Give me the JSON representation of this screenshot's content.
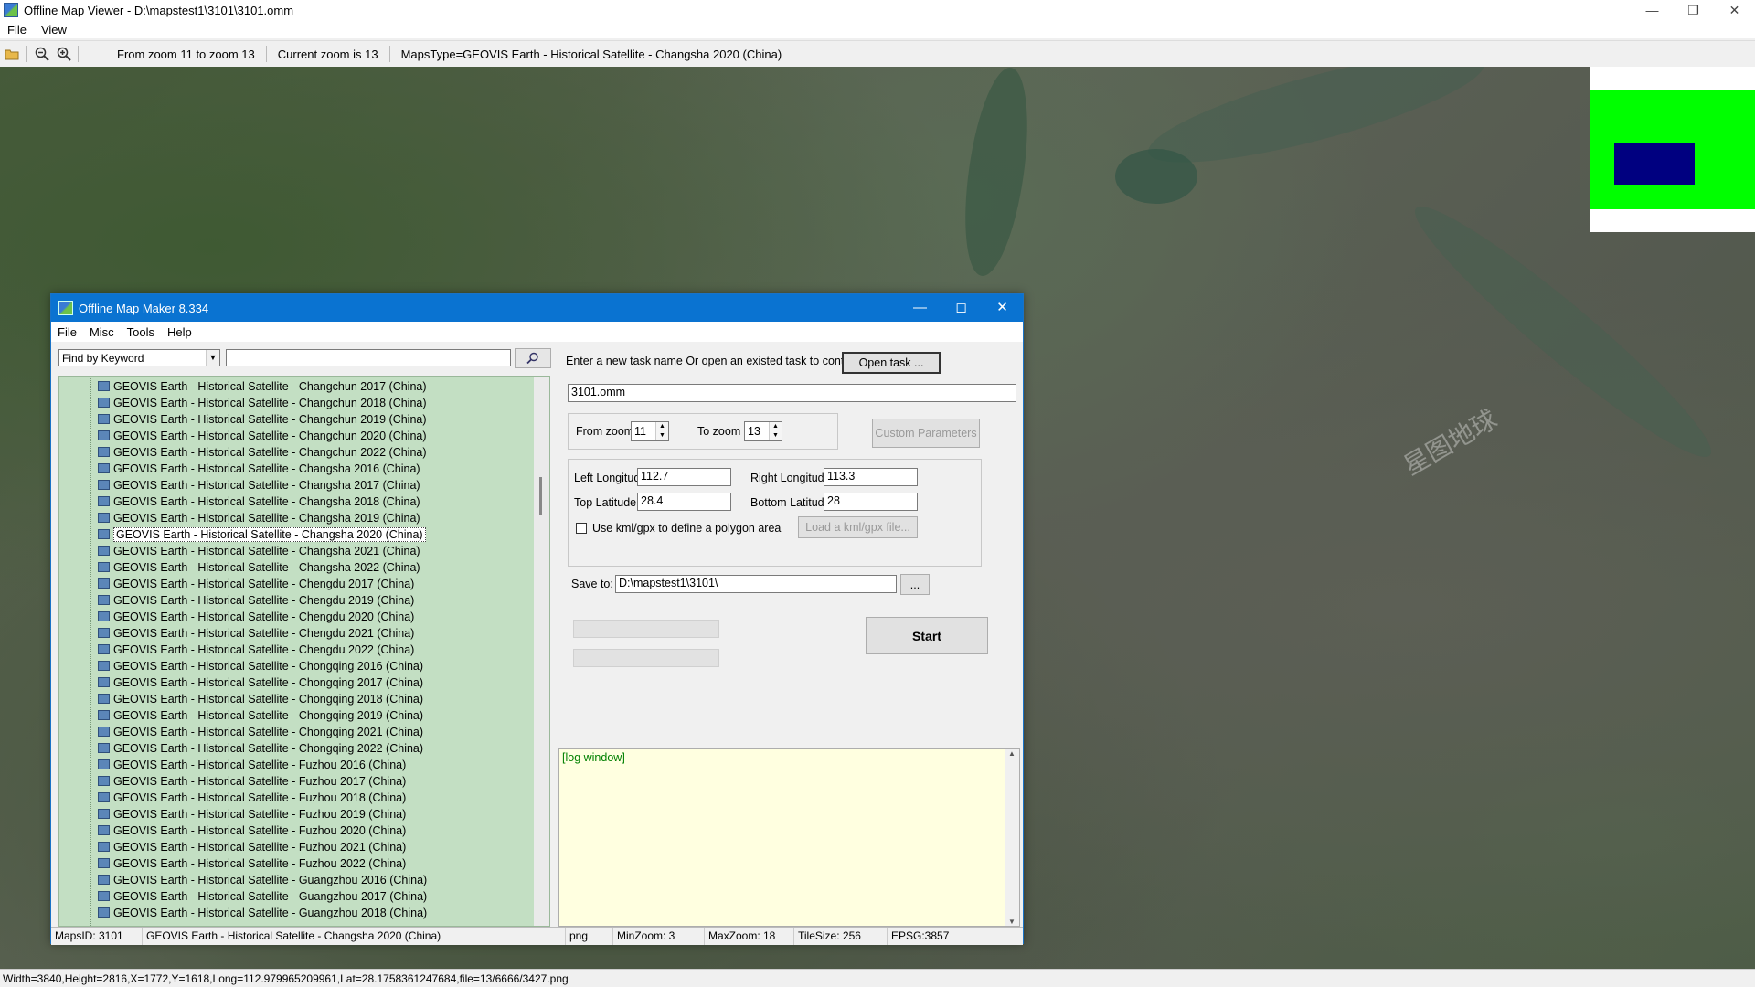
{
  "viewer": {
    "title": "Offline Map Viewer - D:\\mapstest1\\3101\\3101.omm",
    "menu": [
      "File",
      "View"
    ],
    "toolbar": {
      "zoom_range": "From zoom 11 to zoom 13",
      "current_zoom": "Current zoom is 13",
      "maps_type": "MapsType=GEOVIS Earth - Historical Satellite - Changsha 2020 (China)"
    },
    "status": "Width=3840,Height=2816,X=1772,Y=1618,Long=112.979965209961,Lat=28.1758361247684,file=13/6666/3427.png",
    "watermark": "星图地球"
  },
  "dialog": {
    "title": "Offline Map Maker 8.334",
    "menu": [
      "File",
      "Misc",
      "Tools",
      "Help"
    ],
    "find_mode": "Find by Keyword",
    "search_value": "",
    "tree_items": [
      "GEOVIS Earth - Historical Satellite - Changchun 2017 (China)",
      "GEOVIS Earth - Historical Satellite - Changchun 2018 (China)",
      "GEOVIS Earth - Historical Satellite - Changchun 2019 (China)",
      "GEOVIS Earth - Historical Satellite - Changchun 2020 (China)",
      "GEOVIS Earth - Historical Satellite - Changchun 2022 (China)",
      "GEOVIS Earth - Historical Satellite - Changsha 2016 (China)",
      "GEOVIS Earth - Historical Satellite - Changsha 2017 (China)",
      "GEOVIS Earth - Historical Satellite - Changsha 2018 (China)",
      "GEOVIS Earth - Historical Satellite - Changsha 2019 (China)",
      "GEOVIS Earth - Historical Satellite - Changsha 2020 (China)",
      "GEOVIS Earth - Historical Satellite - Changsha 2021 (China)",
      "GEOVIS Earth - Historical Satellite - Changsha 2022 (China)",
      "GEOVIS Earth - Historical Satellite - Chengdu 2017 (China)",
      "GEOVIS Earth - Historical Satellite - Chengdu 2019 (China)",
      "GEOVIS Earth - Historical Satellite - Chengdu 2020 (China)",
      "GEOVIS Earth - Historical Satellite - Chengdu 2021 (China)",
      "GEOVIS Earth - Historical Satellite - Chengdu 2022 (China)",
      "GEOVIS Earth - Historical Satellite - Chongqing 2016 (China)",
      "GEOVIS Earth - Historical Satellite - Chongqing 2017 (China)",
      "GEOVIS Earth - Historical Satellite - Chongqing 2018 (China)",
      "GEOVIS Earth - Historical Satellite - Chongqing 2019 (China)",
      "GEOVIS Earth - Historical Satellite - Chongqing 2021 (China)",
      "GEOVIS Earth - Historical Satellite - Chongqing 2022 (China)",
      "GEOVIS Earth - Historical Satellite - Fuzhou 2016 (China)",
      "GEOVIS Earth - Historical Satellite - Fuzhou 2017 (China)",
      "GEOVIS Earth - Historical Satellite - Fuzhou 2018 (China)",
      "GEOVIS Earth - Historical Satellite - Fuzhou 2019 (China)",
      "GEOVIS Earth - Historical Satellite - Fuzhou 2020 (China)",
      "GEOVIS Earth - Historical Satellite - Fuzhou 2021 (China)",
      "GEOVIS Earth - Historical Satellite - Fuzhou 2022 (China)",
      "GEOVIS Earth - Historical Satellite - Guangzhou 2016 (China)",
      "GEOVIS Earth - Historical Satellite - Guangzhou 2017 (China)",
      "GEOVIS Earth - Historical Satellite - Guangzhou 2018 (China)"
    ],
    "selected_item": "GEOVIS Earth - Historical Satellite - Changsha 2020 (China)",
    "task_prompt": "Enter a new task name Or open an existed task to continue:",
    "open_task_label": "Open task ...",
    "task_name": "3101.omm",
    "from_zoom_label": "From zoom",
    "from_zoom": "11",
    "to_zoom_label": "To zoom",
    "to_zoom": "13",
    "custom_params_label": "Custom Parameters",
    "left_long_label": "Left Longitude",
    "left_long": "112.7",
    "right_long_label": "Right Longitude",
    "right_long": "113.3",
    "top_lat_label": "Top Latitude",
    "top_lat": "28.4",
    "bottom_lat_label": "Bottom Latitude",
    "bottom_lat": "28",
    "kml_label": "Use kml/gpx to define a polygon area",
    "load_kml_label": "Load a kml/gpx file...",
    "save_to_label": "Save to:",
    "save_to": "D:\\mapstest1\\3101\\",
    "browse_label": "...",
    "start_label": "Start",
    "log_text": "[log window]",
    "status": {
      "maps_id": "MapsID: 3101",
      "maps_name": "GEOVIS Earth - Historical Satellite - Changsha 2020 (China)",
      "format": "png",
      "min_zoom": "MinZoom: 3",
      "max_zoom": "MaxZoom: 18",
      "tile_size": "TileSize: 256",
      "epsg": "EPSG:3857"
    }
  }
}
